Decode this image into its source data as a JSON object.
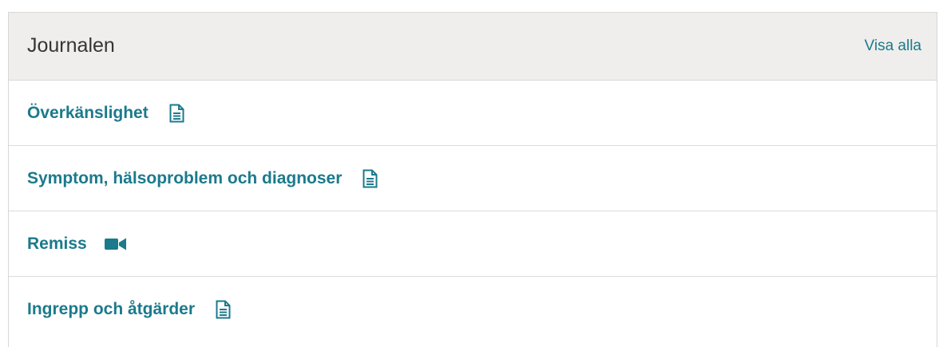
{
  "panel": {
    "title": "Journalen",
    "view_all_label": "Visa alla",
    "accent_color": "#1b7a8c",
    "items": [
      {
        "label": "Överkänslighet",
        "icon": "document-icon"
      },
      {
        "label": "Symptom, hälsoproblem och diagnoser",
        "icon": "document-icon"
      },
      {
        "label": "Remiss",
        "icon": "video-camera-icon"
      },
      {
        "label": "Ingrepp och åtgärder",
        "icon": "document-icon"
      }
    ]
  }
}
